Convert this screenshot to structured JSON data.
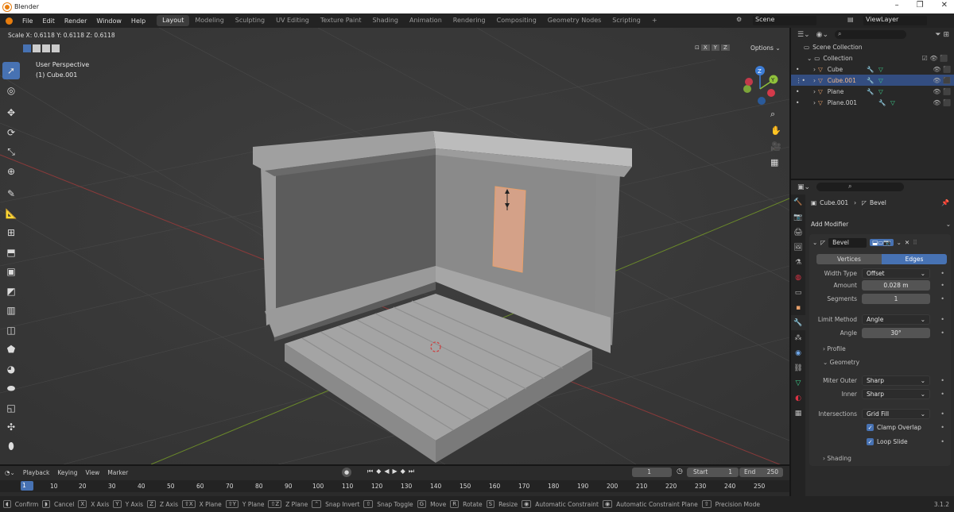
{
  "window": {
    "title": "Blender",
    "minimize": "–",
    "maximize": "❐",
    "close": "✕"
  },
  "menu": [
    "File",
    "Edit",
    "Render",
    "Window",
    "Help"
  ],
  "workspaces": [
    "Layout",
    "Modeling",
    "Sculpting",
    "UV Editing",
    "Texture Paint",
    "Shading",
    "Animation",
    "Rendering",
    "Compositing",
    "Geometry Nodes",
    "Scripting"
  ],
  "workspace_add": "+",
  "scene": {
    "label": "Scene",
    "viewlayer": "ViewLayer"
  },
  "viewport": {
    "header_text": "Scale X: 0.6118   Y: 0.6118   Z: 0.6118",
    "perspective": "User Perspective",
    "active_object": "(1) Cube.001",
    "options": "Options",
    "axes": [
      "X",
      "Y",
      "Z"
    ]
  },
  "outliner": {
    "root": "Scene Collection",
    "collection": "Collection",
    "items": [
      "Cube",
      "Cube.001",
      "Plane",
      "Plane.001"
    ]
  },
  "properties": {
    "breadcrumb_object": "Cube.001",
    "breadcrumb_modifier": "Bevel",
    "add_modifier": "Add Modifier",
    "modifier_name": "Bevel",
    "affect_tabs": [
      "Vertices",
      "Edges"
    ],
    "active_affect": "Edges",
    "width_type": {
      "label": "Width Type",
      "value": "Offset"
    },
    "amount": {
      "label": "Amount",
      "value": "0.028 m"
    },
    "segments": {
      "label": "Segments",
      "value": "1"
    },
    "limit_method": {
      "label": "Limit Method",
      "value": "Angle"
    },
    "angle": {
      "label": "Angle",
      "value": "30°"
    },
    "profile": "Profile",
    "geometry": "Geometry",
    "miter_outer": {
      "label": "Miter Outer",
      "value": "Sharp"
    },
    "inner": {
      "label": "Inner",
      "value": "Sharp"
    },
    "intersections": {
      "label": "Intersections",
      "value": "Grid Fill"
    },
    "clamp_overlap": "Clamp Overlap",
    "loop_slide": "Loop Slide",
    "shading": "Shading"
  },
  "timeline": {
    "menus": [
      "Playback",
      "Keying",
      "View",
      "Marker"
    ],
    "current_frame": "1",
    "start_label": "Start",
    "start": "1",
    "end_label": "End",
    "end": "250",
    "ticks": [
      "1",
      "10",
      "20",
      "30",
      "40",
      "50",
      "60",
      "70",
      "80",
      "90",
      "100",
      "110",
      "120",
      "130",
      "140",
      "150",
      "160",
      "170",
      "180",
      "190",
      "200",
      "210",
      "220",
      "230",
      "240",
      "250"
    ]
  },
  "status": {
    "items": [
      {
        "key": "",
        "label": "Confirm"
      },
      {
        "key": "",
        "label": "Cancel"
      },
      {
        "key": "X",
        "label": "X Axis"
      },
      {
        "key": "Y",
        "label": "Y Axis"
      },
      {
        "key": "Z",
        "label": "Z Axis"
      },
      {
        "key": "⇧X",
        "label": "X Plane"
      },
      {
        "key": "⇧Y",
        "label": "Y Plane"
      },
      {
        "key": "⇧Z",
        "label": "Z Plane"
      },
      {
        "key": "",
        "label": "Snap Invert"
      },
      {
        "key": "",
        "label": "Snap Toggle"
      },
      {
        "key": "G",
        "label": "Move"
      },
      {
        "key": "R",
        "label": "Rotate"
      },
      {
        "key": "S",
        "label": "Resize"
      },
      {
        "key": "",
        "label": "Automatic Constraint"
      },
      {
        "key": "",
        "label": "Automatic Constraint Plane"
      },
      {
        "key": "",
        "label": "Precision Mode"
      }
    ],
    "version": "3.1.2"
  },
  "colors": {
    "accent": "#4772b3",
    "selected_row": "#334d80",
    "object_orange": "#e8a06a",
    "grid_x": "#8a3a3a",
    "grid_y": "#6b8a2a"
  }
}
